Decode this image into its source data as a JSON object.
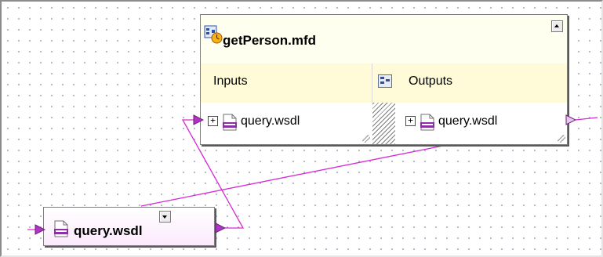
{
  "function_component": {
    "title": "getPerson.mfd",
    "inputs_header": "Inputs",
    "outputs_header": "Outputs",
    "input_item": "query.wsdl",
    "output_item": "query.wsdl",
    "expand_symbol": "+"
  },
  "source_component": {
    "title": "query.wsdl"
  },
  "icons": {
    "function": "mapping-function-icon",
    "wsdl": "wsdl-file-icon",
    "collapse": "collapse-up-icon",
    "dropdown": "dropdown-arrow-icon",
    "connector": "connector-triangle-icon",
    "swap_columns": "column-swap-icon"
  },
  "colors": {
    "wire": "#d62ad6",
    "connector": "#b234c6",
    "title_bg": "#fffff0",
    "header_bg": "#fffbd8",
    "source_gradient": "#fbeafd",
    "canvas_dots": "#9fa9b7"
  }
}
